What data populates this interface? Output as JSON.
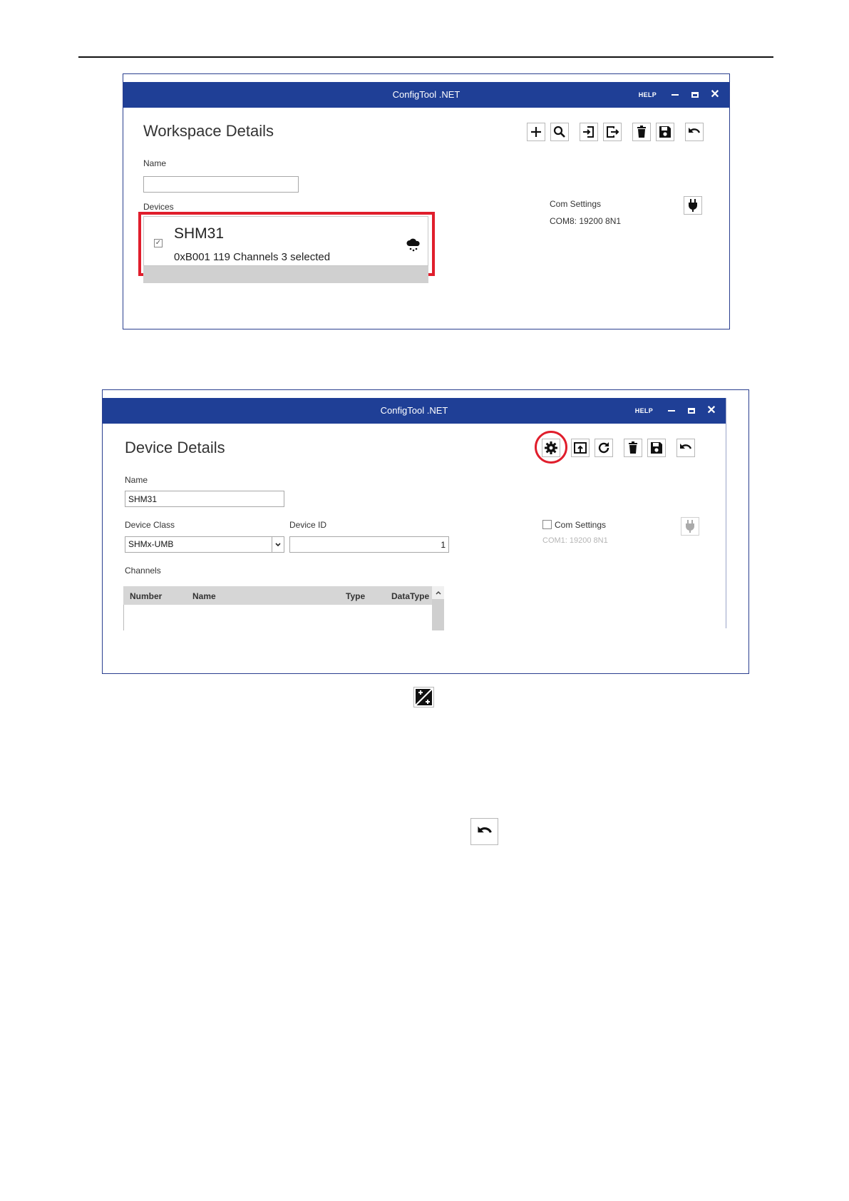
{
  "workspace_window": {
    "title": "ConfigTool .NET",
    "help": "HELP",
    "heading": "Workspace Details",
    "name_label": "Name",
    "name_value": "",
    "devices_label": "Devices",
    "com_settings_label": "Com Settings",
    "com_settings_value": "COM8: 19200 8N1",
    "device": {
      "name": "SHM31",
      "detail": "0xB001 119 Channels 3 selected",
      "checked": "✓"
    },
    "toolbar": [
      "add-icon",
      "search-icon",
      "import-icon",
      "export-icon",
      "delete-icon",
      "save-icon",
      "undo-icon"
    ]
  },
  "device_window": {
    "title": "ConfigTool .NET",
    "help": "HELP",
    "heading": "Device Details",
    "name_label": "Name",
    "name_value": "SHM31",
    "device_class_label": "Device Class",
    "device_class_value": "SHMx-UMB",
    "device_id_label": "Device ID",
    "device_id_value": "1",
    "com_settings_label": "Com Settings",
    "com_settings_value": "COM1: 19200 8N1",
    "channels_label": "Channels",
    "channel_columns": [
      "Number",
      "Name",
      "Type",
      "DataType"
    ],
    "toolbar": [
      "gear-icon",
      "upload-icon",
      "refresh-icon",
      "delete-icon",
      "save-icon",
      "undo-icon"
    ]
  },
  "colors": {
    "titlebar": "#1f3f96",
    "highlight": "#e01e2c"
  }
}
